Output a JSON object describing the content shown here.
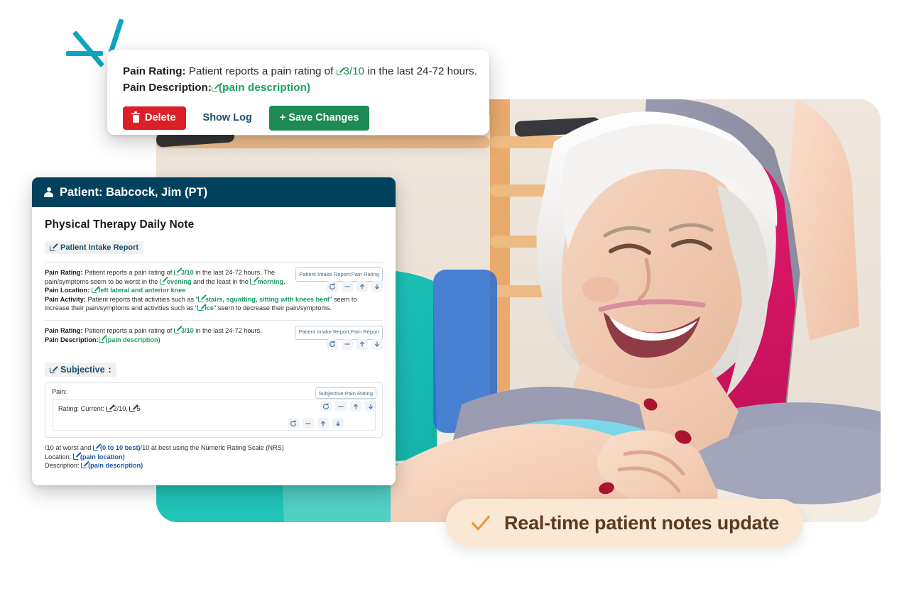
{
  "decor": {
    "sparkle_color": "#11A4C0",
    "photo_alt": "physical therapist stretching a smiling senior woman's arms in a gym"
  },
  "popover": {
    "name": "pain-edit-popover",
    "line1": {
      "label": "Pain Rating:",
      "text_before": "Patient reports a pain rating of",
      "value": "3/10",
      "text_after": "in the last 24-72 hours."
    },
    "line2": {
      "label": "Pain Description:",
      "value": "(pain description)"
    },
    "buttons": {
      "delete": "Delete",
      "show_log": "Show Log",
      "save": "+ Save Changes"
    },
    "colors": {
      "delete": "#DC1F26",
      "save": "#1E8A54",
      "show_log": "#1B4E6B",
      "accent_green": "#19A35F"
    }
  },
  "notecard": {
    "header": {
      "icon": "person-icon",
      "title": "Patient: Babcock, Jim (PT)",
      "bg": "#01415E"
    },
    "title": "Physical Therapy Daily Note",
    "section_tag": "Patient Intake Report",
    "controls": [
      "refresh-icon",
      "minus-icon",
      "arrow-up-icon",
      "arrow-down-icon"
    ],
    "blocks": [
      {
        "tag": "Patient Intake Report:Pain Rating",
        "lines": [
          {
            "label": "Pain Rating:",
            "t1": "Patient reports a pain rating of",
            "v1": "3/10",
            "t2": "in the last 24-72 hours. The pain/symptoms seem to be worst in the",
            "v2": "evening",
            "t3": "and the least in the",
            "v3": "morning",
            "t4": "."
          },
          {
            "label": "Pain Location:",
            "v1": "left lateral and anterior knee"
          },
          {
            "label": "Pain Activity:",
            "t1": "Patient reports that activities such as \"",
            "v1": "stairs, squatting, sitting with knees bent",
            "t2": "\" seem to increase their pain/symptoms and activities such as \"",
            "v2": "ice",
            "t3": "\" seem to decrease their pain/symptoms."
          }
        ]
      },
      {
        "tag": "Patient Intake Report:Pain Report",
        "lines": [
          {
            "label": "Pain Rating:",
            "t1": "Patient reports a pain rating of",
            "v1": "3/10",
            "t2": "in the last 24-72 hours."
          },
          {
            "label": "Pain Description:",
            "v1": "(pain description)"
          }
        ]
      }
    ],
    "subjective": {
      "tag_label": "Subjective",
      "tag_colon": ":",
      "panel_tag": "Subjective:Pain Rating",
      "pain_label": "Pain:",
      "rating_label": "Rating: Current:",
      "rating_value": "2/10,",
      "rating_value2": "5",
      "footer_line1_a": "/10 at worst and",
      "footer_line1_v": "(0 to 10 best)",
      "footer_line1_b": "/10 at best using the Numeric Rating Scale (NRS)",
      "footer_location_label": "Location:",
      "footer_location_value": "(pain location)",
      "footer_description_label": "Description:",
      "footer_description_value": "(pain description)"
    }
  },
  "badge": {
    "icon": "check-icon",
    "text": "Real-time patient notes update",
    "bg": "#FAE8D5",
    "text_color": "#5A3B20",
    "check_color": "#E79A3C"
  }
}
